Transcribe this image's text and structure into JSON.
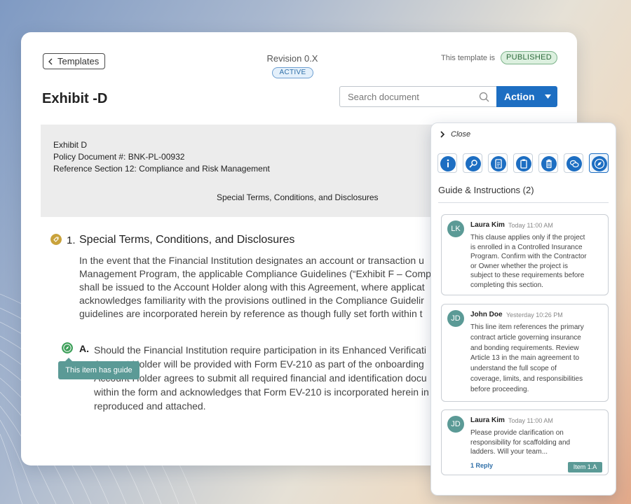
{
  "header": {
    "back_label": "Templates",
    "revision": "Revision 0.X",
    "revision_status": "ACTIVE",
    "template_state_label": "This template is",
    "template_state": "PUBLISHED",
    "title": "Exhibit -D",
    "search_placeholder": "Search document",
    "action_label": "Action"
  },
  "doc_header": {
    "line1": "Exhibit D",
    "line2": "Policy Document #: BNK-PL-00932",
    "line3": "Reference Section 12: Compliance and Risk Management",
    "centered": "Special Terms, Conditions, and Disclosures"
  },
  "section": {
    "number": "1.",
    "title": "Special Terms, Conditions, and Disclosures",
    "body": [
      "In the event that the Financial Institution designates an account or transaction u",
      "Management Program, the applicable Compliance Guidelines (“Exhibit F – Comp",
      "shall be issued to the Account Holder along with this Agreement, where applicat",
      "acknowledges familiarity with the provisions outlined in the Compliance Guidelir",
      "guidelines are incorporated herein by reference as though fully set forth within t"
    ]
  },
  "subsection": {
    "letter": "A.",
    "body": [
      "Should the Financial Institution require participation in its Enhanced Verificati",
      "Account Holder will be provided with Form EV-210 as part of the onboarding",
      "Account Holder agrees to submit all required financial and identification docu",
      "within the form and acknowledges that Form EV-210 is incorporated herein in",
      "reproduced and attached."
    ],
    "tooltip": "This item has guide"
  },
  "panel": {
    "close_label": "Close",
    "tools": [
      "info-icon",
      "search-icon",
      "document-icon",
      "clipboard-icon",
      "trash-icon",
      "chat-icon",
      "compass-icon"
    ],
    "guide_title": "Guide & Instructions (2)",
    "comments": [
      {
        "initials": "LK",
        "name": "Laura Kim",
        "time": "Today 11:00 AM",
        "lines": [
          "This clause applies only if the project",
          "is enrolled in a Controlled Insurance",
          "Program. Confirm with the Contractor",
          "or Owner whether the project is",
          "subject to these requirements before",
          "completing this section."
        ]
      },
      {
        "initials": "JD",
        "name": "John Doe",
        "time": "Yesterday 10:26 PM",
        "lines": [
          "This line item references the primary",
          "contract article governing insurance",
          "and bonding requirements. Review",
          "Article 13 in the main agreement to",
          "understand the full scope of",
          "coverage, limits, and responsibilities",
          "before proceeding."
        ]
      },
      {
        "initials": "JD",
        "name": "Laura Kim",
        "time": "Today 11:00 AM",
        "lines": [
          "Please provide clarification on",
          "responsibility for scaffolding and",
          "ladders. Will your team..."
        ],
        "reply": "1 Reply",
        "tag": "Item 1.A"
      }
    ]
  },
  "colors": {
    "primary": "#1d6ec2",
    "teal": "#5b9a96",
    "published_bg": "#dcf0df",
    "active_bg": "#e4f0fb"
  }
}
